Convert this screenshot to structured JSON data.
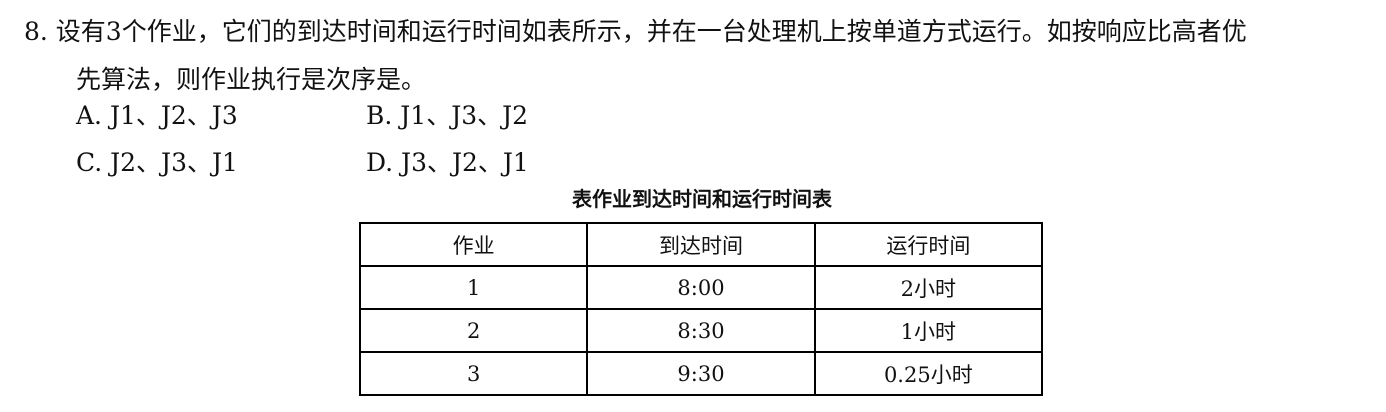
{
  "question": {
    "line1": "8. 设有3个作业，它们的到达时间和运行时间如表所示，并在一台处理机上按单道方式运行。如按响应比高者优",
    "line2": "先算法，则作业执行是次序是。"
  },
  "options": [
    {
      "label": "A. J1、J2、J3"
    },
    {
      "label": "B. J1、J3、J2"
    },
    {
      "label": "C. J2、J3、J1"
    },
    {
      "label": "D. J3、J2、J1"
    }
  ],
  "table": {
    "caption": "表作业到达时间和运行时间表",
    "headers": [
      "作业",
      "到达时间",
      "运行时间"
    ],
    "rows": [
      [
        "1",
        "8:00",
        "2小时"
      ],
      [
        "2",
        "8:30",
        "1小时"
      ],
      [
        "3",
        "9:30",
        "0.25小时"
      ]
    ]
  }
}
